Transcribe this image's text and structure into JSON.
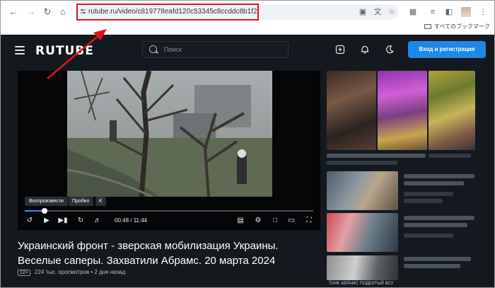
{
  "browser": {
    "url": "rutube.ru/video/c819778eafd120c53345c8ccddc8b1f2/",
    "bookmarks_label": "すべてのブックマーク"
  },
  "site": {
    "logo": "RUTUBE",
    "search_placeholder": "Поиск",
    "login_label": "Вход и регистрация"
  },
  "player": {
    "tooltip_label": "Воспроизвести",
    "shortcut_key_1": "Пробел",
    "shortcut_key_2": "K",
    "time": "00:48 / 11:44",
    "progress_fraction": 0.068
  },
  "video": {
    "title": "Украинский фронт - зверская мобилизация Украины. Веселые саперы. Захватили Абрамс. 20 марта 2024",
    "age_rating": "12+",
    "views": "224 тыс. просмотров",
    "posted": "2 дня назад"
  },
  "recommendations": {
    "caption": "ТАНК АБРАМС ПОДБИТЫЙ ВСУ"
  },
  "colors": {
    "site_bg": "#14191f",
    "accent": "#1e88e5",
    "annotation": "#e0141b"
  }
}
